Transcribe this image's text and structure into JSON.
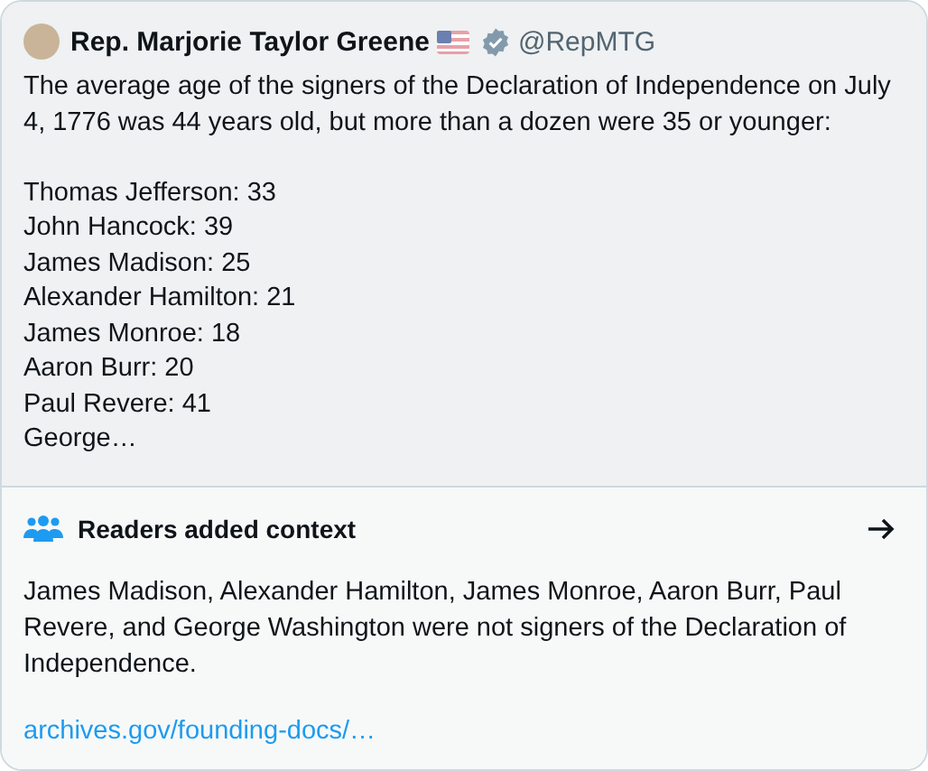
{
  "post": {
    "author": "Rep. Marjorie Taylor Greene",
    "verified": true,
    "handle": "@RepMTG",
    "intro": "The average age of the signers of the Declaration of Independence on July 4, 1776 was 44 years old, but more than a dozen were 35 or younger:",
    "list": [
      "Thomas Jefferson: 33",
      "John Hancock: 39",
      "James Madison: 25",
      "Alexander Hamilton: 21",
      "James Monroe: 18",
      "Aaron Burr: 20",
      "Paul Revere: 41",
      "George…"
    ]
  },
  "context": {
    "title": "Readers added context",
    "note": "James Madison, Alexander Hamilton, James Monroe, Aaron Burr, Paul Revere, and George Washington were not signers of the Declaration of Independence.",
    "link": "archives.gov/founding-docs/…"
  }
}
